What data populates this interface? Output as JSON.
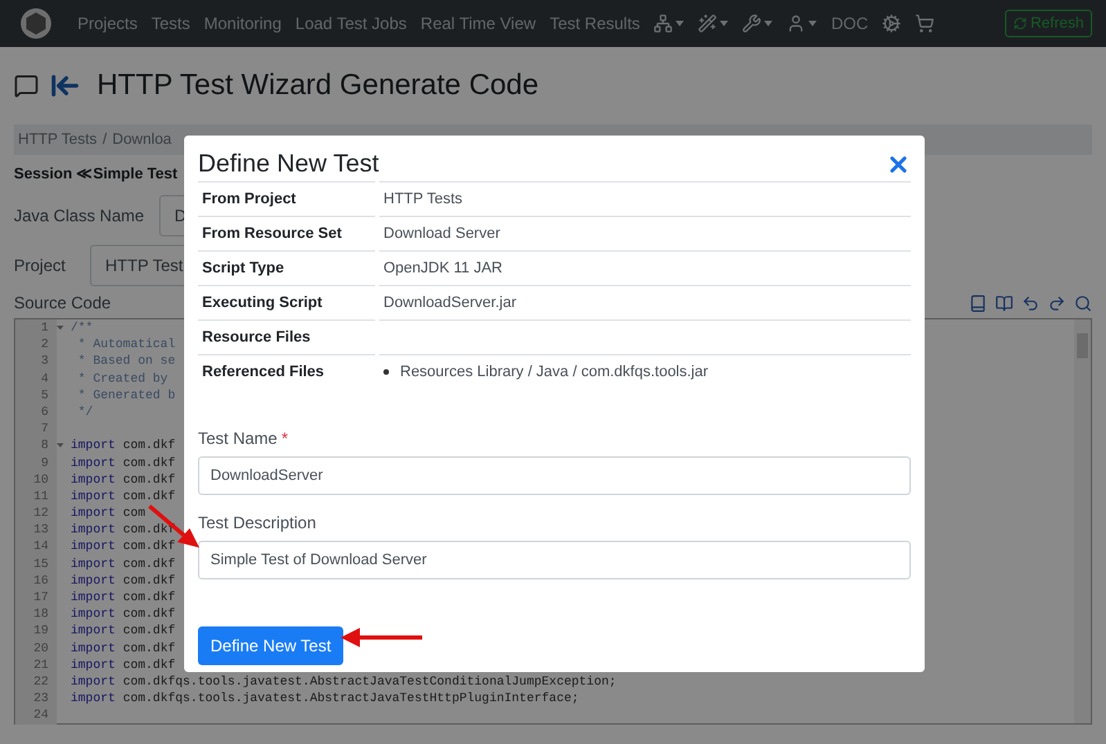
{
  "navbar": {
    "menu": [
      {
        "label": "Projects"
      },
      {
        "label": "Tests"
      },
      {
        "label": "Monitoring"
      },
      {
        "label": "Load Test Jobs"
      },
      {
        "label": "Real Time View"
      },
      {
        "label": "Test Results"
      }
    ],
    "icon_menus": [
      {
        "kind": "network"
      },
      {
        "kind": "wand"
      },
      {
        "kind": "tools"
      },
      {
        "kind": "user"
      }
    ],
    "doc": "DOC",
    "refresh": "Refresh"
  },
  "page": {
    "title": "HTTP Test Wizard Generate Code",
    "breadcrumb": {
      "items": [
        "HTTP Tests",
        "Downloa"
      ],
      "separator": "/"
    },
    "session": "Session ≪Simple Test",
    "fields": [
      {
        "label": "Java Class Name",
        "value": "D"
      },
      {
        "label": "Project",
        "value": "HTTP Test"
      }
    ],
    "source_label": "Source Code",
    "code_lines": [
      {
        "number": "1",
        "kind": "comment",
        "text": "/**",
        "fold": true
      },
      {
        "number": "2",
        "kind": "comment",
        "text": " * Automatical",
        "fold": false
      },
      {
        "number": "3",
        "kind": "comment",
        "text": " * Based on se",
        "fold": false
      },
      {
        "number": "4",
        "kind": "comment",
        "text": " * Created by",
        "fold": false
      },
      {
        "number": "5",
        "kind": "comment",
        "text": " * Generated b",
        "fold": false
      },
      {
        "number": "6",
        "kind": "comment",
        "text": " */",
        "fold": false
      },
      {
        "number": "7",
        "kind": "blank",
        "fold": false
      },
      {
        "number": "8",
        "kind": "import",
        "keyword": "import",
        "text": "com.dkf",
        "fold": true
      },
      {
        "number": "9",
        "kind": "import",
        "keyword": "import",
        "text": "com.dkf",
        "fold": false
      },
      {
        "number": "10",
        "kind": "import",
        "keyword": "import",
        "text": "com.dkf",
        "fold": false
      },
      {
        "number": "11",
        "kind": "import",
        "keyword": "import",
        "text": "com.dkf",
        "fold": false
      },
      {
        "number": "12",
        "kind": "import",
        "keyword": "import",
        "text": "com",
        "fold": false
      },
      {
        "number": "13",
        "kind": "import",
        "keyword": "import",
        "text": "com.dkf",
        "fold": false
      },
      {
        "number": "14",
        "kind": "import",
        "keyword": "import",
        "text": "com.dkf",
        "fold": false
      },
      {
        "number": "15",
        "kind": "import",
        "keyword": "import",
        "text": "com.dkf",
        "fold": false
      },
      {
        "number": "16",
        "kind": "import",
        "keyword": "import",
        "text": "com.dkf",
        "fold": false
      },
      {
        "number": "17",
        "kind": "import",
        "keyword": "import",
        "text": "com.dkf",
        "fold": false
      },
      {
        "number": "18",
        "kind": "import",
        "keyword": "import",
        "text": "com.dkf",
        "fold": false
      },
      {
        "number": "19",
        "kind": "import",
        "keyword": "import",
        "text": "com.dkf",
        "fold": false
      },
      {
        "number": "20",
        "kind": "import",
        "keyword": "import",
        "text": "com.dkf",
        "fold": false
      },
      {
        "number": "21",
        "kind": "import",
        "keyword": "import",
        "text": "com.dkf",
        "fold": false
      },
      {
        "number": "22",
        "kind": "import",
        "keyword": "import",
        "text": "com.dkfqs.tools.javatest.AbstractJavaTestConditionalJumpException;",
        "fold": false
      },
      {
        "number": "23",
        "kind": "import",
        "keyword": "import",
        "text": "com.dkfqs.tools.javatest.AbstractJavaTestHttpPluginInterface;",
        "fold": false
      },
      {
        "number": "24",
        "kind": "blank",
        "fold": false
      }
    ]
  },
  "dialog": {
    "title": "Define New Test",
    "rows": [
      {
        "label": "From Project",
        "value": "HTTP Tests"
      },
      {
        "label": "From Resource Set",
        "value": "Download Server"
      },
      {
        "label": "Script Type",
        "value": "OpenJDK 11 JAR"
      },
      {
        "label": "Executing Script",
        "value": "DownloadServer.jar"
      },
      {
        "label": "Resource Files"
      },
      {
        "label": "Referenced Files",
        "files": [
          "Resources Library / Java / com.dkfqs.tools.jar"
        ]
      }
    ],
    "fields": [
      {
        "label": "Test Name",
        "required_mark": "*",
        "value": "DownloadServer"
      },
      {
        "label": "Test Description",
        "value": "Simple Test of Download Server"
      }
    ],
    "button": "Define New Test"
  }
}
